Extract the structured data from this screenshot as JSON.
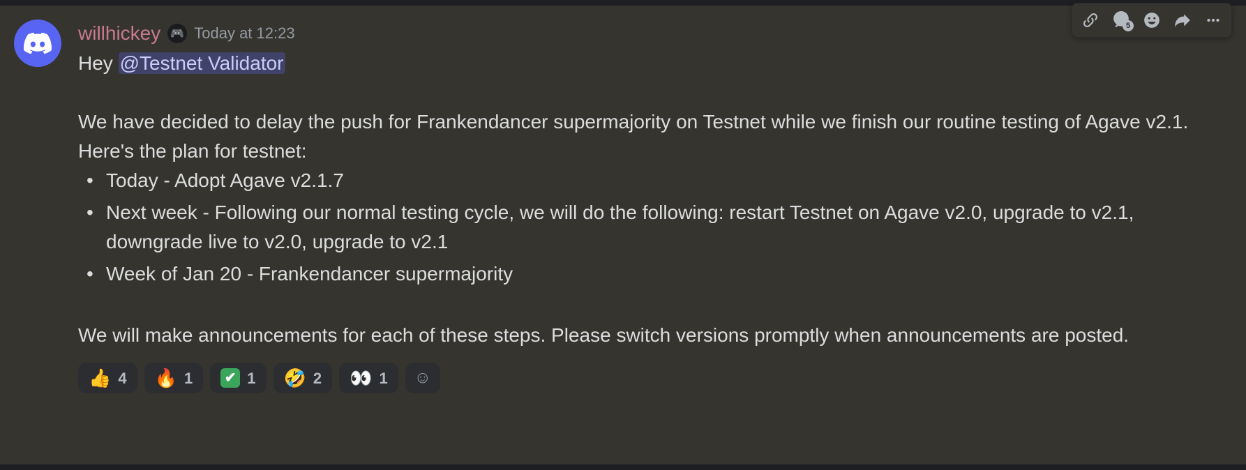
{
  "message": {
    "author": {
      "username": "willhickey",
      "badge_icon": "game-controller"
    },
    "timestamp": "Today at 12:23",
    "greeting": "Hey ",
    "mention": "@Testnet Validator",
    "paragraph1": "We have decided to delay the push for Frankendancer supermajority on Testnet while we finish our routine testing of Agave v2.1. Here's the plan for testnet:",
    "bullets": [
      "Today - Adopt Agave v2.1.7",
      "Next week - Following our normal testing cycle, we will do the following: restart Testnet on Agave v2.0, upgrade to v2.1, downgrade live to v2.0, upgrade to v2.1",
      "Week of Jan 20 - Frankendancer supermajority"
    ],
    "paragraph2": "We will make announcements for each of these steps. Please switch versions promptly when announcements are posted."
  },
  "reactions": [
    {
      "emoji": "👍",
      "count": "4",
      "name": "thumbs-up"
    },
    {
      "emoji": "🔥",
      "count": "1",
      "name": "fire"
    },
    {
      "emoji": "✔",
      "count": "1",
      "name": "check-mark",
      "style": "checkmark"
    },
    {
      "emoji": "🤣",
      "count": "2",
      "name": "rofl"
    },
    {
      "emoji": "👀",
      "count": "1",
      "name": "eyes"
    }
  ],
  "toolbar": {
    "thread_count": "5"
  }
}
